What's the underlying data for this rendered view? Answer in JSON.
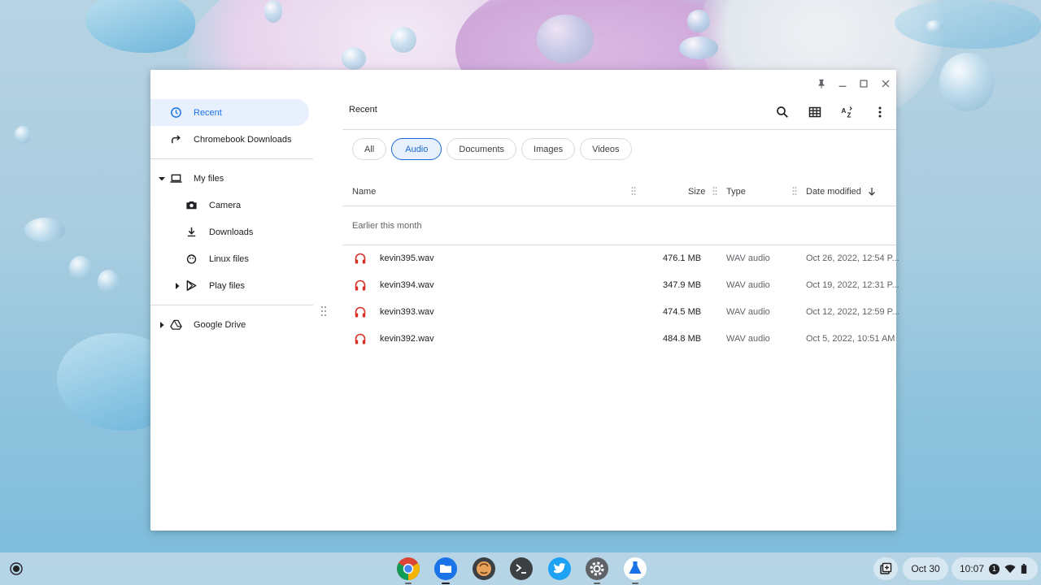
{
  "window": {
    "controls": [
      "pin-icon",
      "minimize-icon",
      "maximize-icon",
      "close-icon"
    ]
  },
  "sidebar": {
    "items": [
      {
        "label": "Recent",
        "icon": "clock-icon"
      },
      {
        "label": "Chromebook Downloads",
        "icon": "shortcut-arrow-icon"
      },
      {
        "label": "My files",
        "icon": "laptop-icon"
      },
      {
        "label": "Camera",
        "icon": "camera-icon"
      },
      {
        "label": "Downloads",
        "icon": "download-icon"
      },
      {
        "label": "Linux files",
        "icon": "linux-icon"
      },
      {
        "label": "Play files",
        "icon": "play-icon"
      },
      {
        "label": "Google Drive",
        "icon": "drive-icon"
      }
    ]
  },
  "main": {
    "title": "Recent",
    "toolbar": [
      "search-icon",
      "grid-view-icon",
      "sort-az-icon",
      "more-vert-icon"
    ],
    "filters": [
      "All",
      "Audio",
      "Documents",
      "Images",
      "Videos"
    ],
    "active_filter": "Audio",
    "columns": {
      "name": "Name",
      "size": "Size",
      "type": "Type",
      "date": "Date modified"
    },
    "group_label": "Earlier this month",
    "files": [
      {
        "name": "kevin395.wav",
        "size": "476.1 MB",
        "type": "WAV audio",
        "date": "Oct 26, 2022, 12:54 P..."
      },
      {
        "name": "kevin394.wav",
        "size": "347.9 MB",
        "type": "WAV audio",
        "date": "Oct 19, 2022, 12:31 P..."
      },
      {
        "name": "kevin393.wav",
        "size": "474.5 MB",
        "type": "WAV audio",
        "date": "Oct 12, 2022, 12:59 P..."
      },
      {
        "name": "kevin392.wav",
        "size": "484.8 MB",
        "type": "WAV audio",
        "date": "Oct 5, 2022, 10:51 AM"
      }
    ]
  },
  "shelf": {
    "apps": [
      "chrome-icon",
      "files-icon",
      "app-icon",
      "terminal-icon",
      "twitter-icon",
      "settings-icon",
      "lab-icon"
    ],
    "date": "Oct 30",
    "time": "10:07",
    "notification_count": "1"
  },
  "colors": {
    "accent": "#1a73e8",
    "audio_icon": "#d93025"
  }
}
